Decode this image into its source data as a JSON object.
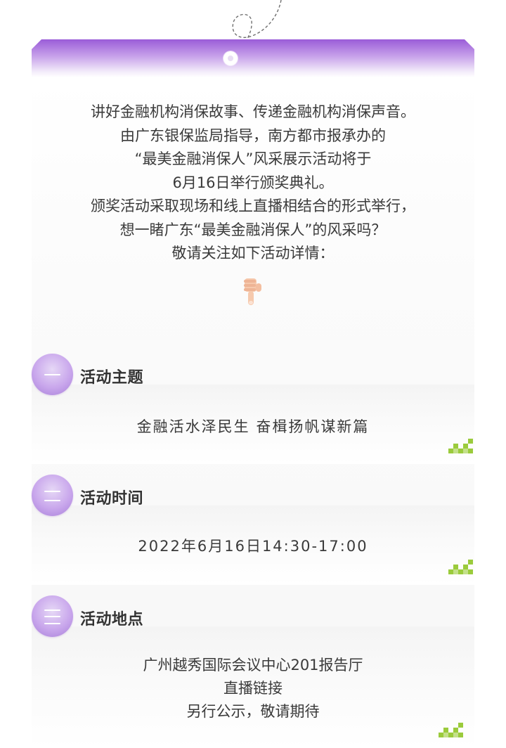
{
  "intro": {
    "lines": [
      "讲好金融机构消保故事、传递金融机构消保声音。",
      "由广东银保监局指导，南方都市报承办的",
      "“最美金融消保人”风采展示活动将于",
      "6月16日举行颁奖典礼。",
      "颁奖活动采取现场和线上直播相结合的形式举行，",
      "想一睹广东“最美金融消保人”的风采吗？",
      "敬请关注如下活动详情："
    ],
    "pointer_icon": "pointing-down-hand-icon"
  },
  "sections": [
    {
      "numeral": "一",
      "title": "活动主题",
      "lines": [
        "金融活水泽民生 奋楫扬帆谋新篇"
      ]
    },
    {
      "numeral": "二",
      "title": "活动时间",
      "lines": [
        "2022年6月16日14:30-17:00"
      ]
    },
    {
      "numeral": "三",
      "title": "活动地点",
      "lines": [
        "广州越秀国际会议中心201报告厅",
        "直播链接",
        "另行公示，敬请期待"
      ]
    }
  ],
  "colors": {
    "accent_purple": "#a77ed9",
    "accent_green": "#9bcb3c",
    "text": "#333333"
  }
}
